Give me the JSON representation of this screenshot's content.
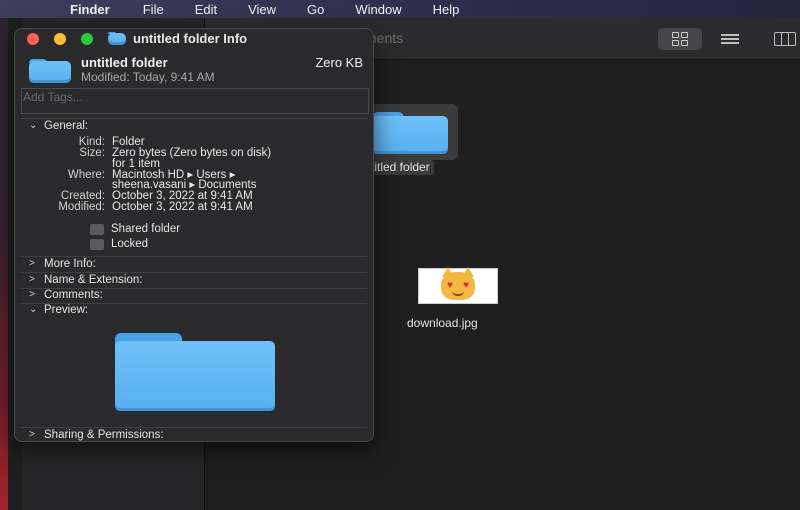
{
  "menubar": {
    "apple_icon": "apple-logo",
    "app_name": "Finder",
    "items": [
      "File",
      "Edit",
      "View",
      "Go",
      "Window",
      "Help"
    ]
  },
  "finder": {
    "title_partial": "ments",
    "items": [
      {
        "name": "untitled folder",
        "label_shown": "titled folder",
        "selected": true,
        "icon": "folder-icon"
      },
      {
        "name": "download.jpg",
        "label_shown": "download.jpg",
        "selected": false,
        "icon": "image-thumbnail"
      }
    ]
  },
  "info": {
    "title": "untitled folder Info",
    "name": "untitled folder",
    "size": "Zero KB",
    "modified_header": "Modified:  Today, 9:41 AM",
    "tags_placeholder": "Add Tags...",
    "general": {
      "heading": "General:",
      "rows": [
        {
          "key": "Kind:",
          "value": "Folder"
        },
        {
          "key": "Size:",
          "value": "Zero bytes (Zero bytes on disk)"
        },
        {
          "key": "",
          "value": "for 1 item"
        },
        {
          "key": "Where:",
          "value": "Macintosh HD ▸ Users ▸"
        },
        {
          "key": "",
          "value": "sheena.vasani ▸ Documents"
        },
        {
          "key": "Created:",
          "value": "October 3, 2022 at 9:41 AM"
        },
        {
          "key": "Modified:",
          "value": "October 3, 2022 at 9:41 AM"
        }
      ],
      "shared_folder": "Shared folder",
      "locked": "Locked"
    },
    "sections": {
      "more_info": "More Info:",
      "name_extension": "Name & Extension:",
      "comments": "Comments:",
      "preview": "Preview:",
      "sharing": "Sharing & Permissions:"
    }
  },
  "colors": {
    "folder_blue": "#6ec0f7",
    "close": "#ff5f57",
    "minimize": "#febc2e",
    "maximize": "#28c840"
  }
}
